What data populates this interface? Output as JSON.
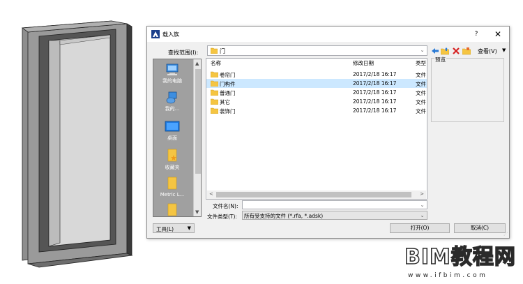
{
  "dialog": {
    "title": "载入族",
    "help": "?",
    "close": "✕"
  },
  "lookin": {
    "label": "查找范围(I):",
    "value": "门"
  },
  "toolbar": {
    "views_label": "查看(V)"
  },
  "places": [
    {
      "label": "我的电脑",
      "icon": "computer-icon"
    },
    {
      "label": "我的...",
      "icon": "network-icon"
    },
    {
      "label": "桌面",
      "icon": "desktop-icon"
    },
    {
      "label": "收藏夹",
      "icon": "favorites-icon"
    },
    {
      "label": "Metric L...",
      "icon": "folder-icon"
    },
    {
      "label": "",
      "icon": "folder-icon"
    }
  ],
  "filelist": {
    "headers": {
      "name": "名称",
      "date": "修改日期",
      "type": "类型"
    },
    "rows": [
      {
        "name": "卷帘门",
        "date": "2017/2/18 16:17",
        "type": "文件",
        "selected": false
      },
      {
        "name": "门构件",
        "date": "2017/2/18 16:17",
        "type": "文件",
        "selected": true
      },
      {
        "name": "普通门",
        "date": "2017/2/18 16:17",
        "type": "文件",
        "selected": false
      },
      {
        "name": "其它",
        "date": "2017/2/18 16:17",
        "type": "文件",
        "selected": false
      },
      {
        "name": "装饰门",
        "date": "2017/2/18 16:17",
        "type": "文件",
        "selected": false
      }
    ]
  },
  "preview": {
    "label": "预览"
  },
  "filename": {
    "label": "文件名(N):",
    "value": ""
  },
  "filetype": {
    "label": "文件类型(T):",
    "value": "所有受支持的文件 (*.rfa, *.adsk)"
  },
  "buttons": {
    "tools": "工具(L)",
    "open": "打开(O)",
    "cancel": "取消(C)"
  },
  "watermark": {
    "main": "BIM教程网",
    "url": "www.ifbim.com"
  },
  "colors": {
    "selection": "#cce8ff",
    "places_bg": "#a0a0a0",
    "folder": "#f5c542",
    "accent": "#1e6fd9"
  }
}
